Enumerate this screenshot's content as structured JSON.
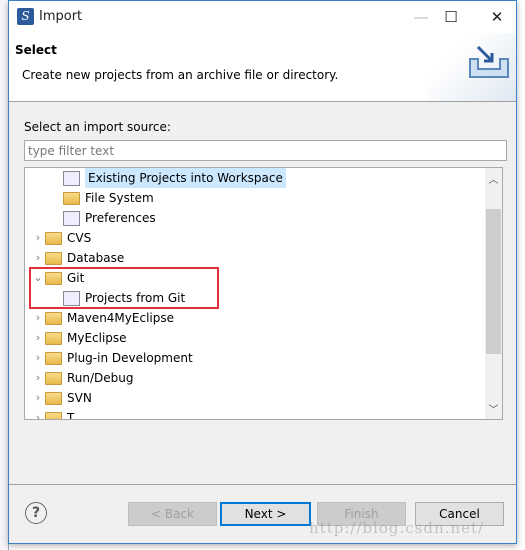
{
  "window": {
    "title": "Import",
    "minimize": "—",
    "maximize": "☐",
    "close": "✕"
  },
  "header": {
    "title": "Select",
    "description": "Create new projects from an archive file or directory."
  },
  "source_label": "Select an import source:",
  "filter": {
    "placeholder": "type filter text",
    "value": ""
  },
  "tree": [
    {
      "label": "Existing Projects into Workspace",
      "level": 1,
      "icon": "import-project-icon",
      "selected": true
    },
    {
      "label": "File System",
      "level": 1,
      "icon": "folder-icon"
    },
    {
      "label": "Preferences",
      "level": 1,
      "icon": "preferences-icon"
    },
    {
      "label": "CVS",
      "level": 0,
      "icon": "folder-icon",
      "expanded": false
    },
    {
      "label": "Database",
      "level": 0,
      "icon": "folder-icon",
      "expanded": false
    },
    {
      "label": "Git",
      "level": 0,
      "icon": "folder-icon",
      "expanded": true
    },
    {
      "label": "Projects from Git",
      "level": 1,
      "icon": "git-icon"
    },
    {
      "label": "Maven4MyEclipse",
      "level": 0,
      "icon": "folder-icon",
      "expanded": false
    },
    {
      "label": "MyEclipse",
      "level": 0,
      "icon": "folder-icon",
      "expanded": false
    },
    {
      "label": "Plug-in Development",
      "level": 0,
      "icon": "folder-icon",
      "expanded": false
    },
    {
      "label": "Run/Debug",
      "level": 0,
      "icon": "folder-icon",
      "expanded": false
    },
    {
      "label": "SVN",
      "level": 0,
      "icon": "folder-icon",
      "expanded": false
    },
    {
      "label": "T...",
      "level": 0,
      "icon": "folder-icon",
      "expanded": false
    }
  ],
  "buttons": {
    "back": "< Back",
    "next": "Next >",
    "finish": "Finish",
    "cancel": "Cancel"
  },
  "watermark": "http://blog.csdn.net/",
  "colors": {
    "accent": "#0078d7",
    "highlight_box": "#e0303a",
    "selection": "#cce8ff"
  }
}
